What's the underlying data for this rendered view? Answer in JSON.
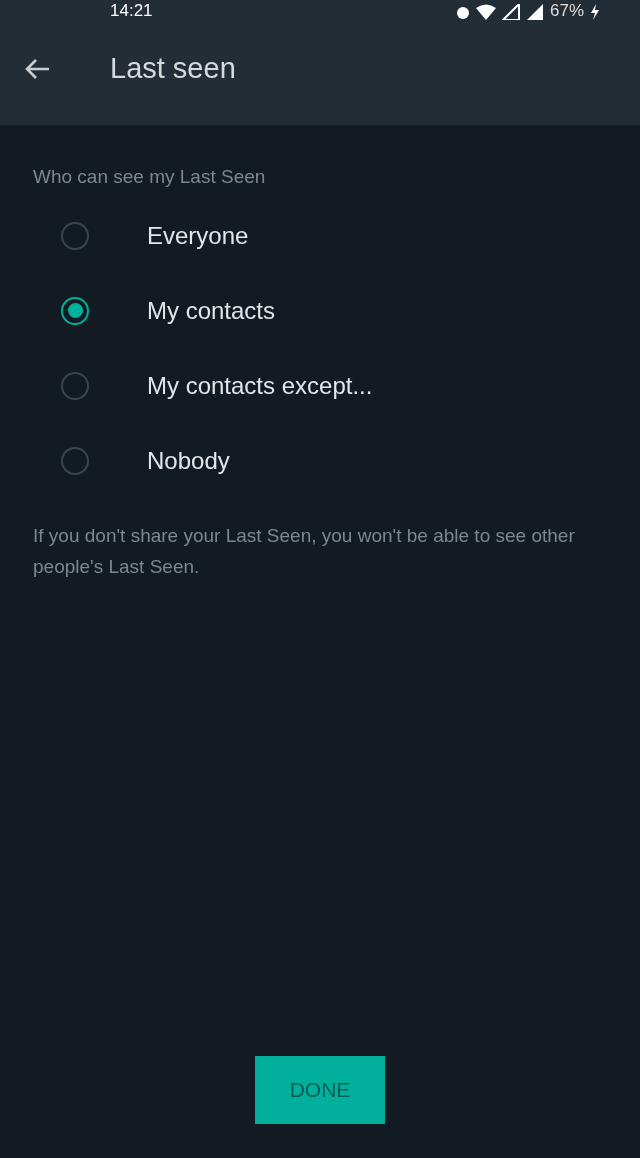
{
  "status_bar": {
    "time": "14:21",
    "battery": "67%"
  },
  "app_bar": {
    "title": "Last seen"
  },
  "section_label": "Who can see my Last Seen",
  "options": [
    {
      "label": "Everyone",
      "selected": false
    },
    {
      "label": "My contacts",
      "selected": true
    },
    {
      "label": "My contacts except...",
      "selected": false
    },
    {
      "label": "Nobody",
      "selected": false
    }
  ],
  "note": "If you don't share your Last Seen, you won't be able to see other people's Last Seen.",
  "done_button": "DONE"
}
